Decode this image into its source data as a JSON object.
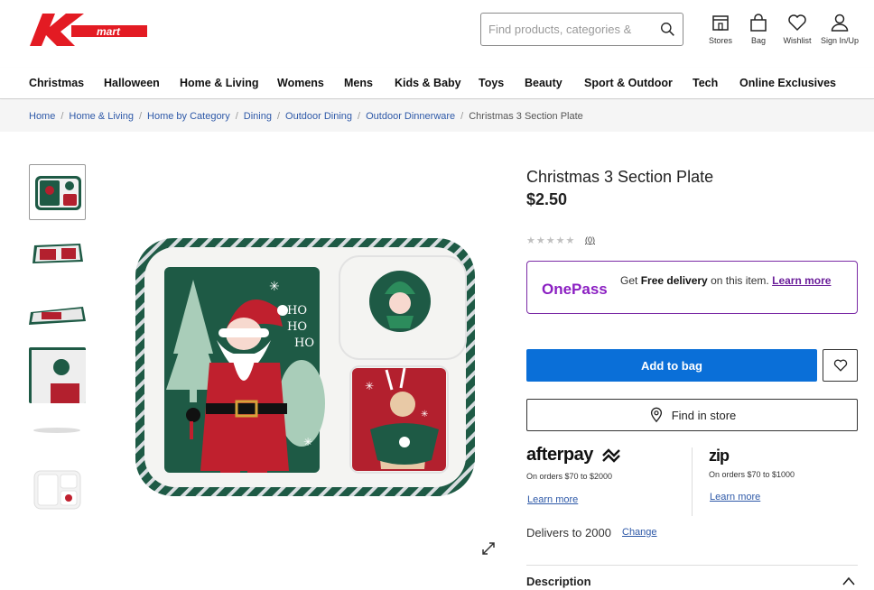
{
  "brand": {
    "logo_text": "Kmart",
    "color": "#e31b23"
  },
  "search": {
    "placeholder": "Find products, categories &"
  },
  "header_icons": [
    {
      "label": "Stores",
      "icon": "store-icon"
    },
    {
      "label": "Bag",
      "icon": "bag-icon"
    },
    {
      "label": "Wishlist",
      "icon": "heart-icon"
    },
    {
      "label": "Sign In/Up",
      "icon": "user-icon"
    }
  ],
  "nav": [
    "Christmas",
    "Halloween",
    "Home & Living",
    "Womens",
    "Mens",
    "Kids & Baby",
    "Toys",
    "Beauty",
    "Sport & Outdoor",
    "Tech",
    "Online Exclusives"
  ],
  "breadcrumb": {
    "links": [
      "Home",
      "Home & Living",
      "Home by Category",
      "Dining",
      "Outdoor Dining",
      "Outdoor Dinnerware"
    ],
    "current": "Christmas 3 Section Plate"
  },
  "product": {
    "title": "Christmas 3 Section Plate",
    "price": "$2.50",
    "stars": "★★★★★",
    "rating_value": 0,
    "review_count": "(0)",
    "image_caption_lines": [
      "HO",
      "HO",
      "HO"
    ]
  },
  "onepass": {
    "logo": "OnePass",
    "text_get": "Get ",
    "text_bold": "Free delivery",
    "text_rest": " on this item. ",
    "learn_more": "Learn more"
  },
  "actions": {
    "add_to_bag": "Add to bag",
    "find_in_store": "Find in store"
  },
  "afterpay": {
    "logo": "afterpay",
    "note": "On orders $70 to $2000",
    "link": "Learn more"
  },
  "zip": {
    "logo": "zip",
    "note": "On orders $70 to $1000",
    "link": "Learn more"
  },
  "delivery": {
    "text": "Delivers to 2000",
    "change": "Change"
  },
  "description": {
    "label": "Description"
  },
  "colors": {
    "primary_button": "#0a6fd8",
    "link": "#2e59a8",
    "onepass": "#8b1fc2",
    "plate_green": "#1e5a45",
    "plate_red": "#b3202e"
  }
}
